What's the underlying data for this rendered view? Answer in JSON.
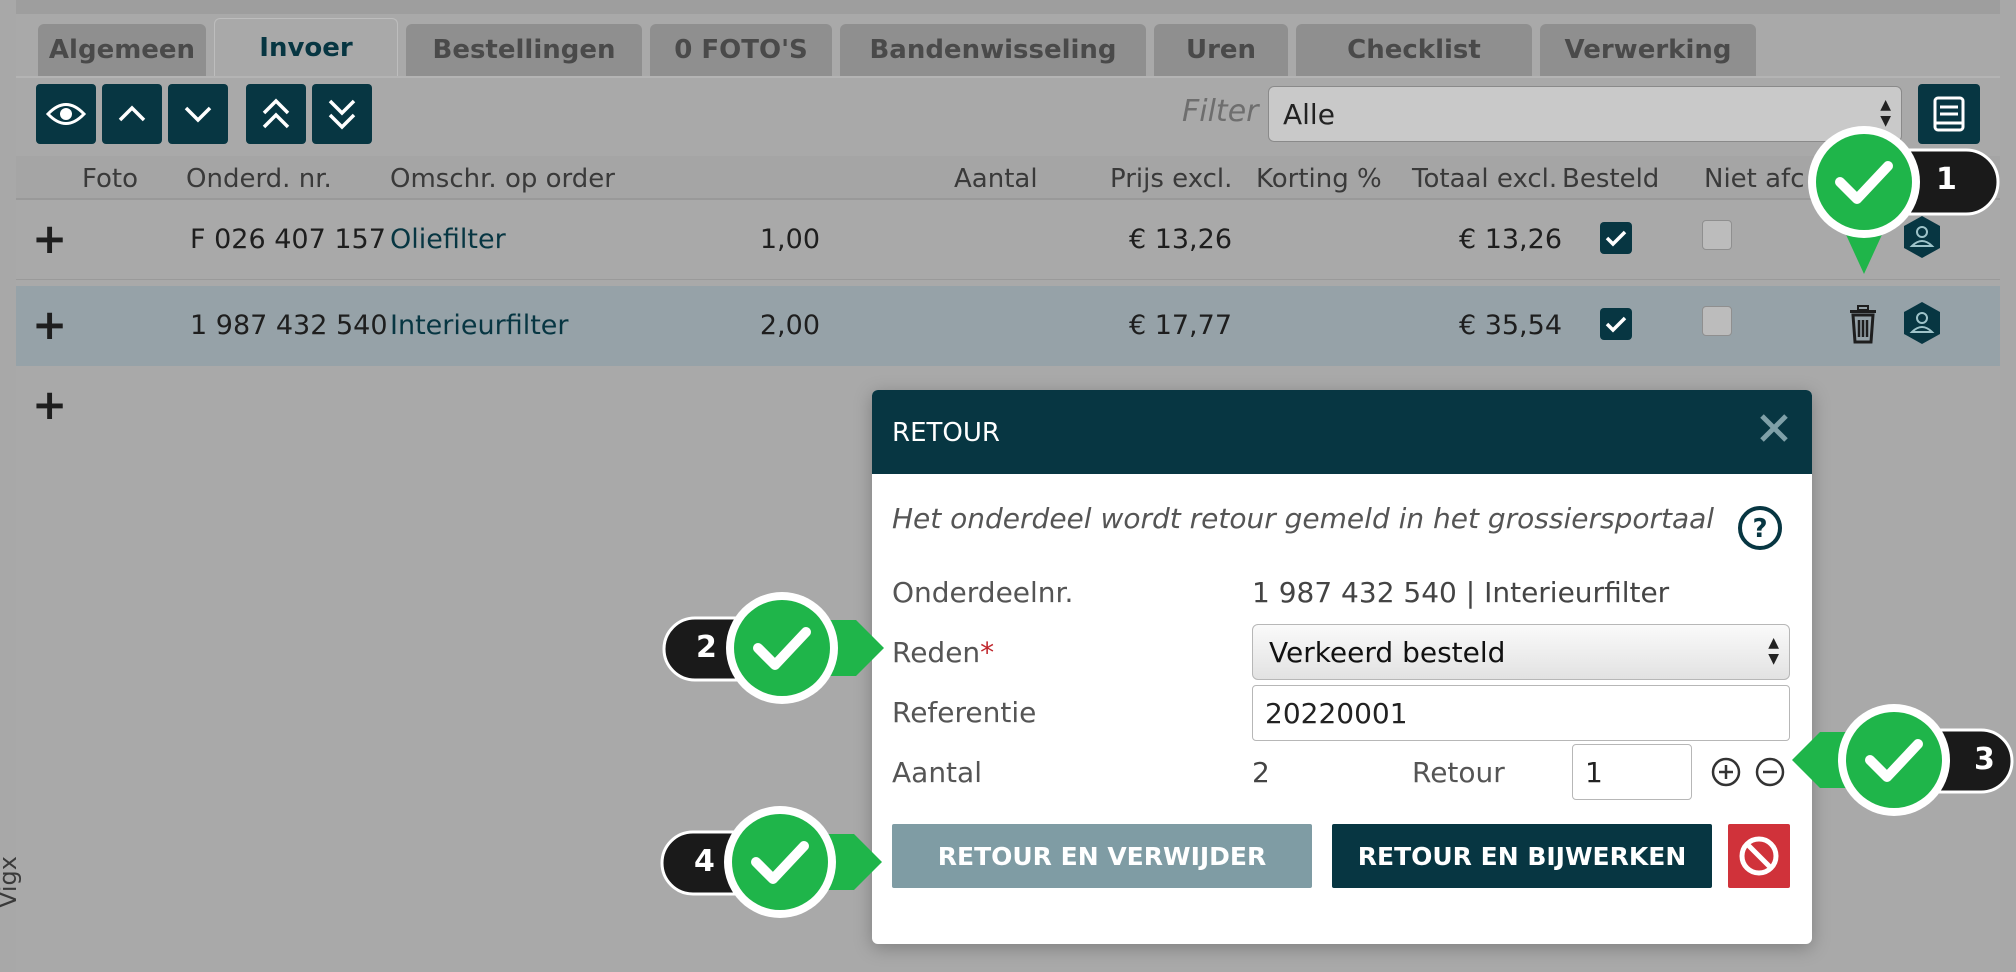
{
  "tabs": [
    "Algemeen",
    "Invoer",
    "Bestellingen",
    "0 FOTO'S",
    "Bandenwisseling",
    "Uren",
    "Checklist",
    "Verwerking"
  ],
  "active_tab": "Invoer",
  "toolbar": {
    "filter_label": "Filter",
    "filter_value": "Alle"
  },
  "table": {
    "headers": [
      "Foto",
      "Onderd. nr.",
      "Omschr. op order",
      "Aantal",
      "Prijs excl.",
      "Korting %",
      "Totaal excl.",
      "Besteld",
      "Niet afc"
    ],
    "rows": [
      {
        "part_no": "F 026 407 157",
        "description": "Oliefilter",
        "qty": "1,00",
        "price": "€ 13,26",
        "discount": "",
        "total": "€ 13,26",
        "ordered": true,
        "not_delivered": false
      },
      {
        "part_no": "1 987 432 540",
        "description": "Interieurfilter",
        "qty": "2,00",
        "price": "€ 17,77",
        "discount": "",
        "total": "€ 35,54",
        "ordered": true,
        "not_delivered": false
      }
    ]
  },
  "side_text": "Vigx",
  "modal": {
    "title": "RETOUR",
    "description": "Het onderdeel wordt retour gemeld in het grossiersportaal",
    "part_label": "Onderdeelnr.",
    "part_value": "1 987 432 540 | Interieurfilter",
    "reason_label": "Reden",
    "reason_required": "*",
    "reason_value": "Verkeerd besteld",
    "reference_label": "Referentie",
    "reference_value": "20220001",
    "qty_label": "Aantal",
    "qty_value": "2",
    "return_label": "Retour",
    "return_value": "1",
    "btn_return_delete": "RETOUR EN VERWIJDER",
    "btn_return_update": "RETOUR EN BIJWERKEN"
  },
  "callouts": [
    "1",
    "2",
    "3",
    "4"
  ],
  "colors": {
    "primary_dark": "#073642",
    "accent_green": "#1fb54a",
    "danger_red": "#d0323a",
    "muted_button": "#7f9ca4"
  }
}
